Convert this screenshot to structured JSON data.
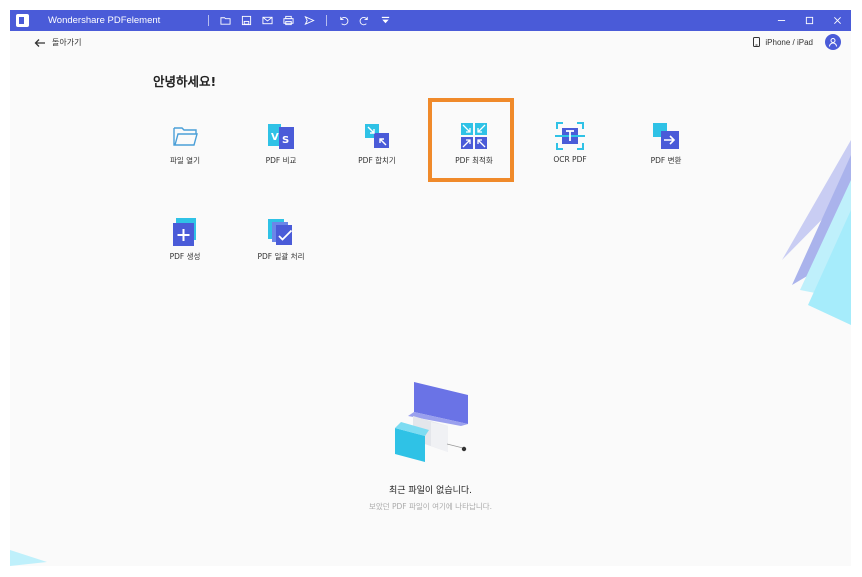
{
  "app": {
    "title": "Wondershare PDFelement"
  },
  "toolbar": {
    "icons": [
      "folder-icon",
      "save-icon",
      "mail-icon",
      "print-icon",
      "send-icon",
      "undo-icon",
      "redo-icon",
      "dropdown-icon"
    ]
  },
  "nav": {
    "back_label": "돌아가기",
    "device_label": "iPhone / iPad"
  },
  "home": {
    "greeting": "안녕하세요!",
    "tiles": [
      {
        "label": "파일 열기",
        "icon": "open-folder-icon"
      },
      {
        "label": "PDF 비교",
        "icon": "vs-compare-icon"
      },
      {
        "label": "PDF 합치기",
        "icon": "combine-icon"
      },
      {
        "label": "PDF 최적화",
        "icon": "optimize-icon"
      },
      {
        "label": "OCR PDF",
        "icon": "ocr-icon"
      },
      {
        "label": "PDF 변환",
        "icon": "convert-icon"
      },
      {
        "label": "PDF 생성",
        "icon": "create-icon"
      },
      {
        "label": "PDF 일괄 처리",
        "icon": "batch-icon"
      }
    ]
  },
  "recent": {
    "empty_title": "최근 파일이 없습니다.",
    "empty_subtitle": "보았던 PDF 파일이 여기에 나타납니다."
  },
  "colors": {
    "titlebar": "#4a5bd8",
    "highlight": "#f08a2a",
    "accent": "#4a5bd8"
  }
}
